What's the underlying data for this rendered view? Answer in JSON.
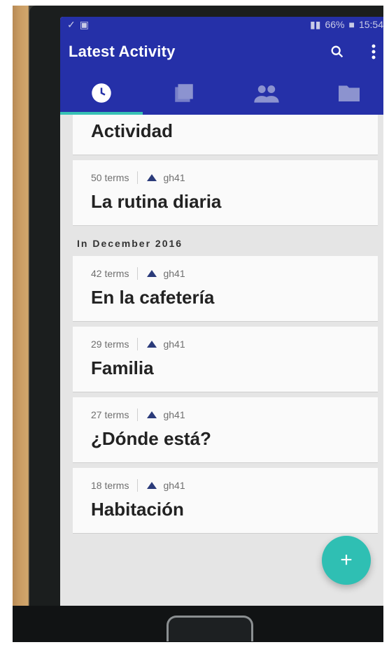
{
  "status_bar": {
    "battery_percent": "66%",
    "time": "15:54"
  },
  "toolbar": {
    "title": "Latest Activity"
  },
  "tabs": [
    {
      "name": "recent",
      "icon": "clock-icon"
    },
    {
      "name": "sets",
      "icon": "stack-icon"
    },
    {
      "name": "classes",
      "icon": "people-icon"
    },
    {
      "name": "folders",
      "icon": "folder-icon"
    }
  ],
  "list": {
    "partial_top_title": "Actividad",
    "items": [
      {
        "terms": "50 terms",
        "user": "gh41",
        "title": "La rutina diaria"
      },
      {
        "terms": "42 terms",
        "user": "gh41",
        "title": "En la cafetería"
      },
      {
        "terms": "29 terms",
        "user": "gh41",
        "title": "Familia"
      },
      {
        "terms": "27 terms",
        "user": "gh41",
        "title": "¿Dónde está?"
      },
      {
        "terms": "18 terms",
        "user": "gh41",
        "title": "Habitación"
      }
    ],
    "section_header": "In December 2016"
  },
  "fab": {
    "symbol": "+"
  },
  "colors": {
    "primary": "#2530a8",
    "accent": "#2fbfb3"
  }
}
